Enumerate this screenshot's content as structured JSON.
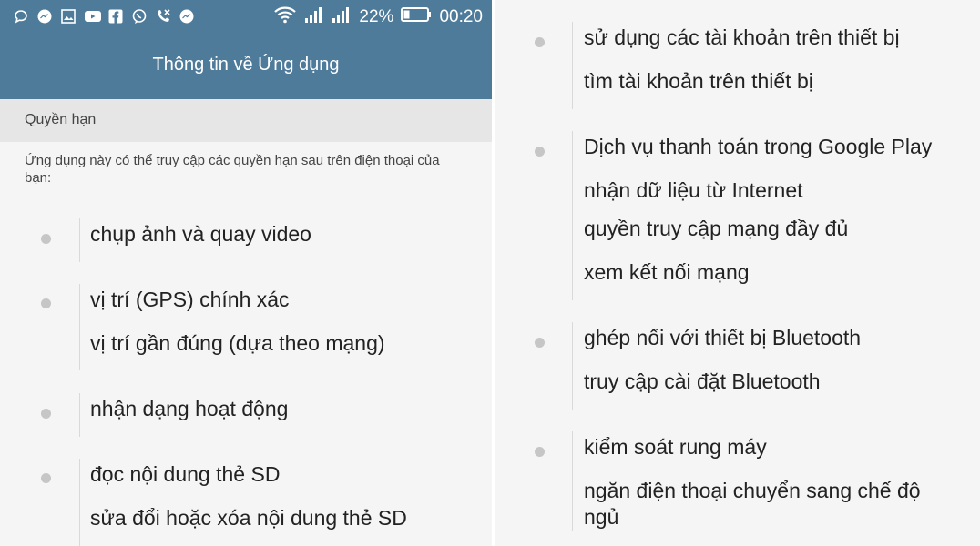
{
  "status_bar": {
    "battery": "22%",
    "time": "00:20",
    "left_icons": [
      "chat-bubble-icon",
      "messenger-icon",
      "image-icon",
      "youtube-icon",
      "facebook-icon",
      "viber-icon",
      "missed-call-icon",
      "messenger-icon"
    ],
    "right_icons": [
      "wifi-icon",
      "signal-icon",
      "signal-icon",
      "battery-icon"
    ]
  },
  "app_bar": {
    "title": "Thông tin về Ứng dụng"
  },
  "section": {
    "header": "Quyền hạn",
    "description": "Ứng dụng này có thể truy cập các quyền hạn sau trên điện thoại của bạn:"
  },
  "left_groups": [
    {
      "items": [
        "chụp ảnh và quay video"
      ]
    },
    {
      "items": [
        "vị trí (GPS) chính xác",
        "vị trí gần đúng (dựa theo mạng)"
      ]
    },
    {
      "items": [
        "nhận dạng hoạt động"
      ]
    },
    {
      "items": [
        "đọc nội dung thẻ SD",
        "sửa đổi hoặc xóa nội dung thẻ SD"
      ]
    }
  ],
  "right_groups": [
    {
      "items": [
        "sử dụng các tài khoản trên thiết bị",
        "tìm tài khoản trên thiết bị"
      ]
    },
    {
      "items": [
        "Dịch vụ thanh toán trong Google Play",
        "nhận dữ liệu từ Internet",
        "quyền truy cập mạng đầy đủ",
        "xem kết nối mạng"
      ]
    },
    {
      "items": [
        "ghép nối với thiết bị Bluetooth",
        "truy cập cài đặt Bluetooth"
      ]
    },
    {
      "items": [
        "kiểm soát rung máy",
        "ngăn điện thoại chuyển sang chế độ ngủ"
      ]
    }
  ],
  "colors": {
    "app_bar": "#4f7b9b",
    "section_header_bg": "#e6e6e6",
    "background": "#f5f5f5",
    "bullet": "#c6c6c6"
  }
}
